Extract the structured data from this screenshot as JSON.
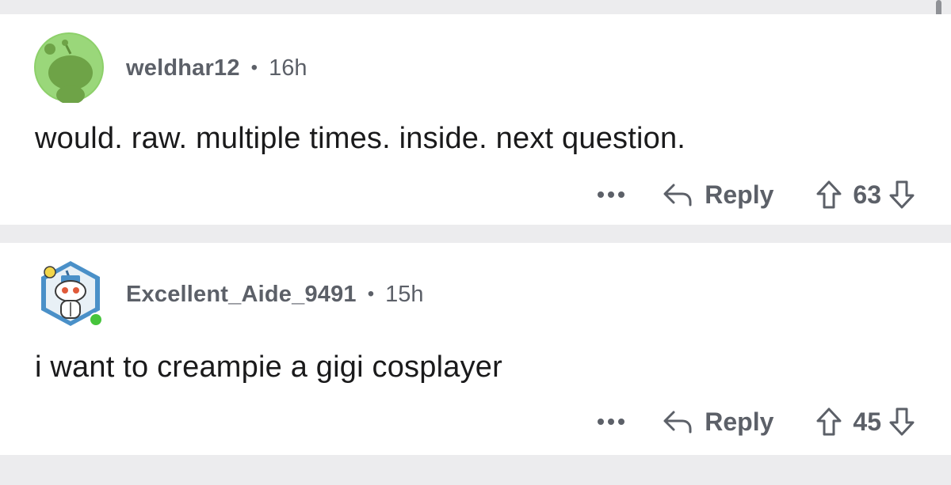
{
  "comments": [
    {
      "username": "weldhar12",
      "separator": "•",
      "age": "16h",
      "body": "would. raw. multiple times. inside. next question.",
      "more_label": "•••",
      "reply_label": "Reply",
      "score": "63",
      "avatar_icon": "snoo-green-avatar-icon"
    },
    {
      "username": "Excellent_Aide_9491",
      "separator": "•",
      "age": "15h",
      "body": "i want to creampie a gigi cosplayer",
      "more_label": "•••",
      "reply_label": "Reply",
      "score": "45",
      "avatar_icon": "snoo-hexagon-avatar-icon",
      "online": true
    }
  ],
  "colors": {
    "background": "#ececee",
    "card": "#ffffff",
    "meta_text": "#5c6068",
    "body_text": "#1a1a1b",
    "avatar_green": "#8dd06a",
    "avatar_hex": "#4a90c8",
    "online_dot": "#46c43c"
  }
}
